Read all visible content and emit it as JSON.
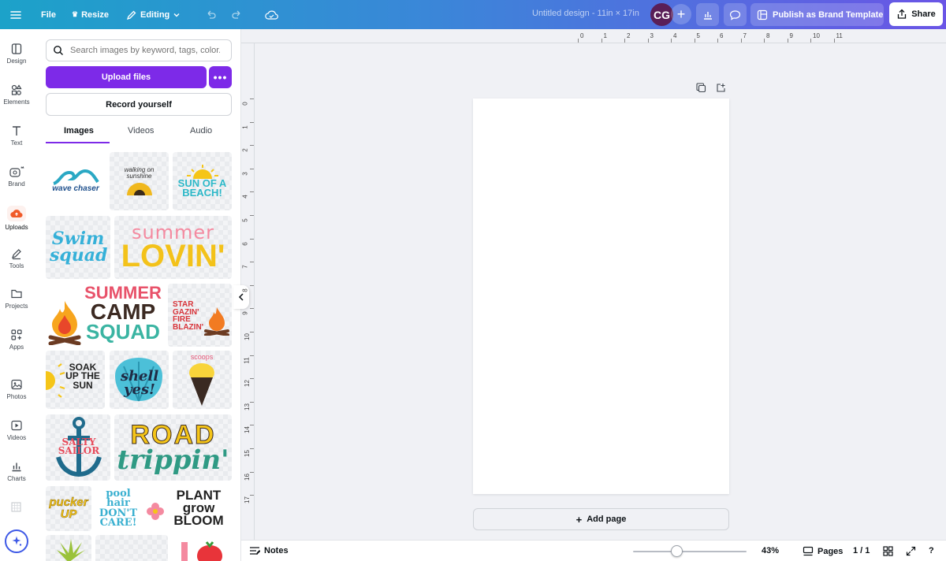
{
  "topbar": {
    "file": "File",
    "resize": "Resize",
    "mode": "Editing",
    "title": "Untitled design - 11in × 17in",
    "avatar_initials": "CG",
    "publish": "Publish as Brand Template",
    "share": "Share"
  },
  "rail": [
    "Design",
    "Elements",
    "Text",
    "Brand",
    "Uploads",
    "Tools",
    "Projects",
    "Apps",
    "Photos",
    "Videos",
    "Charts"
  ],
  "panel": {
    "search_placeholder": "Search images by keyword, tags, color...",
    "upload": "Upload files",
    "more": "•••",
    "record": "Record yourself",
    "tabs": [
      "Images",
      "Videos",
      "Audio"
    ],
    "tiles": {
      "wave": "wave chaser",
      "walking": "walking on sunshine",
      "sunofabeach": "SUN OF A BEACH!",
      "swim": "Swim squad",
      "summer": "summer",
      "lovin": "LOVIN'",
      "camp1": "SUMMER",
      "camp2": "CAMP",
      "camp3": "SQUAD",
      "star": "STAR GAZIN' FIRE BLAZIN'",
      "soak": "SOAK UP THE SUN",
      "shell": "shell yes!",
      "scoops": "scoops",
      "salty": "SALTY SAILOR",
      "road": "ROAD",
      "trippin": "trippin'",
      "pucker": "pucker UP",
      "pool": "pool hair DON'T CARE!",
      "plant": "PLANT grow BLOOM"
    }
  },
  "rulers": {
    "top": [
      "0",
      "1",
      "2",
      "3",
      "4",
      "5",
      "6",
      "7",
      "8",
      "9",
      "10",
      "11"
    ],
    "left": [
      "0",
      "1",
      "2",
      "3",
      "4",
      "5",
      "6",
      "7",
      "8",
      "9",
      "10",
      "11",
      "12",
      "13",
      "14",
      "15",
      "16",
      "17"
    ]
  },
  "canvas": {
    "add_page": "Add page"
  },
  "bottombar": {
    "notes": "Notes",
    "zoom": "43%",
    "zoom_level": 0.43,
    "pages": "Pages",
    "page_count": "1 / 1"
  }
}
